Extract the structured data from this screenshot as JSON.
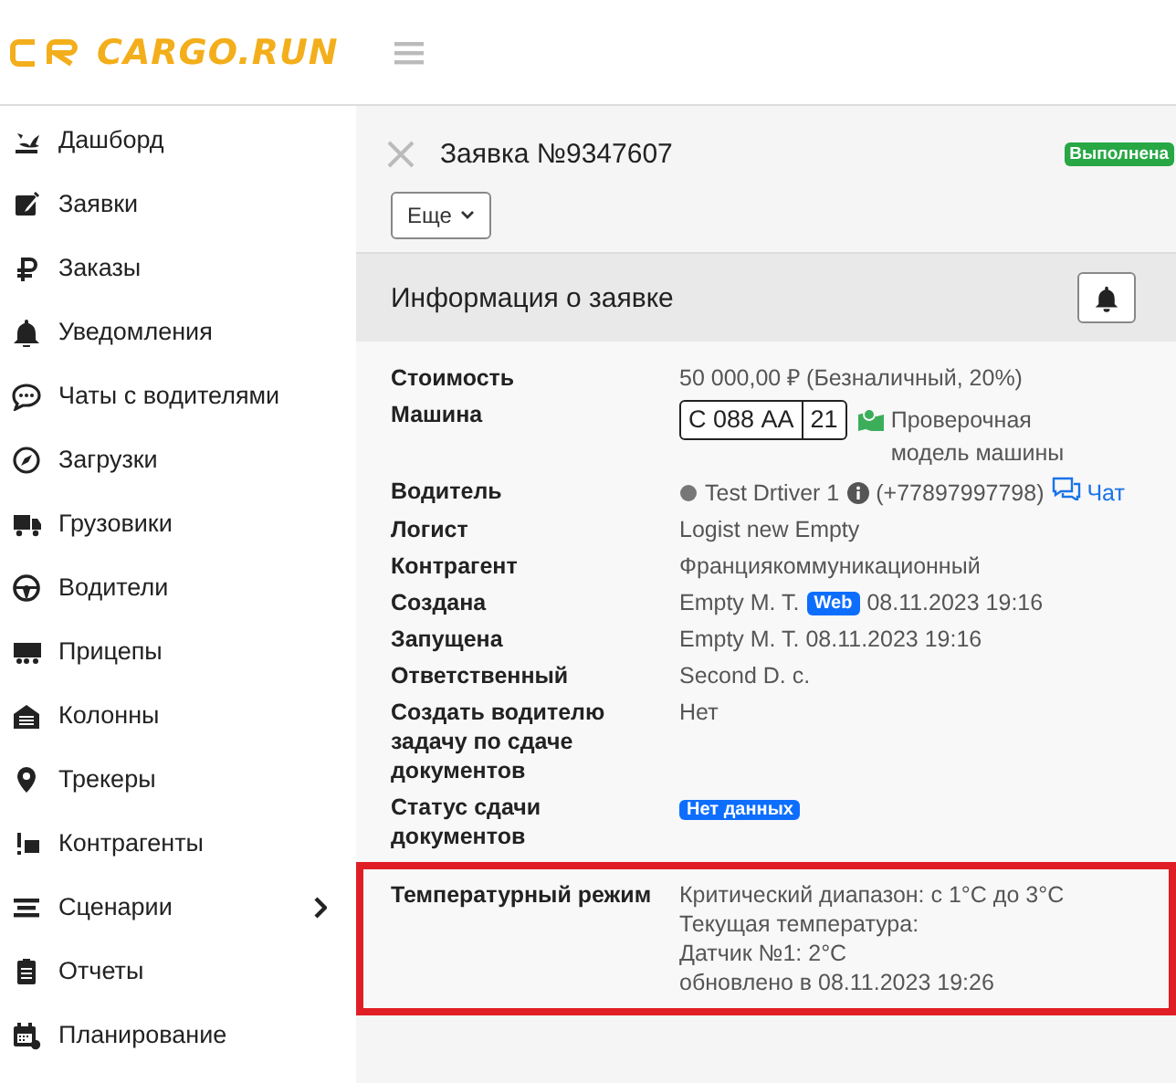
{
  "header": {
    "logo": "CARGO.RUN"
  },
  "sidebar": {
    "items": [
      {
        "label": "Дашборд",
        "kind": "link"
      },
      {
        "label": "Заявки",
        "kind": "link"
      },
      {
        "label": "Заказы",
        "kind": "link"
      },
      {
        "label": "Уведомления",
        "kind": "link"
      },
      {
        "label": "Чаты с водителями",
        "kind": "link"
      },
      {
        "label": "Загрузки",
        "kind": "link"
      },
      {
        "label": "Грузовики",
        "kind": "link"
      },
      {
        "label": "Водители",
        "kind": "link"
      },
      {
        "label": "Прицепы",
        "kind": "link"
      },
      {
        "label": "Колонны",
        "kind": "link"
      },
      {
        "label": "Трекеры",
        "kind": "link"
      },
      {
        "label": "Контрагенты",
        "kind": "link"
      },
      {
        "label": "Сценарии",
        "kind": "group",
        "expanded": false
      },
      {
        "label": "Отчеты",
        "kind": "link"
      },
      {
        "label": "Планирование",
        "kind": "link"
      }
    ]
  },
  "order": {
    "title": "Заявка №9347607",
    "status": "Выполнена",
    "more_button": "Еще",
    "section_title": "Информация о заявке",
    "rows": [
      {
        "label": "Стоимость",
        "kind": "text",
        "value": "50 000,00 ₽ (Безналичный, 20%)",
        "highlighted": false
      },
      {
        "label": "Машина",
        "kind": "plate",
        "plate_number": "С 088 АА",
        "plate_region": "21",
        "value": "Проверочная модель машины",
        "highlighted": false
      },
      {
        "label": "Водитель",
        "kind": "driver",
        "online": false,
        "name": "Test Drtiver 1",
        "phone": "(+77897997798)",
        "link": "Чат",
        "highlighted": false
      },
      {
        "label": "Логист",
        "kind": "text",
        "value": "Logist new Empty",
        "highlighted": false
      },
      {
        "label": "Контрагент",
        "kind": "text",
        "value": "Франциякоммуникационный",
        "highlighted": false
      },
      {
        "label": "Создана",
        "kind": "created",
        "author": "Empty M. T.",
        "badge": "Web",
        "time": "08.11.2023 19:16",
        "highlighted": false
      },
      {
        "label": "Запущена",
        "kind": "text",
        "value": "Empty M. T. 08.11.2023 19:16",
        "highlighted": false
      },
      {
        "label": "Ответственный",
        "kind": "text",
        "value": "Second D. c.",
        "highlighted": false
      },
      {
        "label": "Создать водителю задачу по сдаче документов",
        "kind": "text",
        "value": "Нет",
        "highlighted": false
      },
      {
        "label": "Статус сдачи документов",
        "kind": "badge",
        "value": "Нет данных",
        "highlighted": false
      },
      {
        "label": "Температурный режим",
        "kind": "lines",
        "lines": [
          "Критический диапазон: с 1°C до 3°C",
          "Текущая температура:",
          "Датчик №1: 2°C",
          "обновлено в 08.11.2023 19:26"
        ],
        "highlighted": true
      }
    ]
  }
}
